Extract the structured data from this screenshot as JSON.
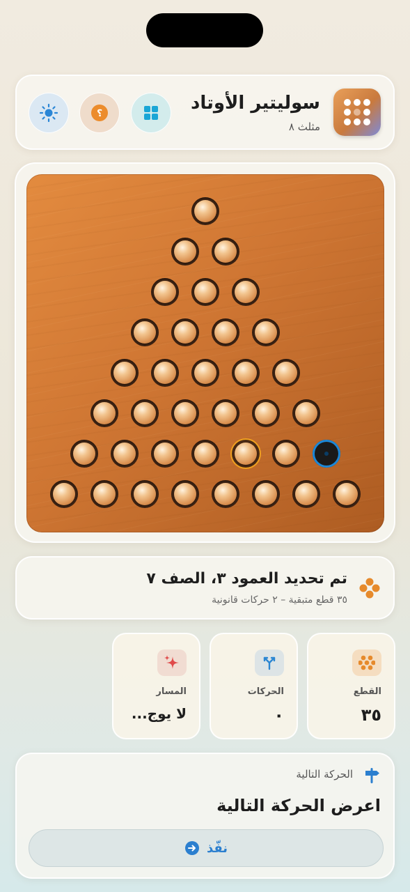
{
  "header": {
    "title": "سوليتير الأوتاد",
    "subtitle": "مثلث ٨"
  },
  "board": {
    "rows": [
      [
        1
      ],
      [
        1,
        1
      ],
      [
        1,
        1,
        1
      ],
      [
        1,
        1,
        1,
        1
      ],
      [
        1,
        1,
        1,
        1,
        1
      ],
      [
        1,
        1,
        1,
        1,
        1,
        1
      ],
      [
        1,
        1,
        1,
        1,
        1,
        1,
        0
      ],
      [
        1,
        1,
        1,
        1,
        1,
        1,
        1,
        1
      ]
    ],
    "selected": {
      "row": 7,
      "col": 5
    },
    "target": {
      "row": 7,
      "col": 7
    }
  },
  "status": {
    "title": "تم تحديد العمود ٣، الصف ٧",
    "subtitle": "٣٥ قطع متبقية – ٢ حركات قانونية"
  },
  "stats": {
    "pieces": {
      "label": "القطع",
      "value": "٣٥"
    },
    "moves": {
      "label": "الحركات",
      "value": "٠"
    },
    "path": {
      "label": "المسار",
      "value": "لا يوج..."
    }
  },
  "next": {
    "label": "الحركة التالية",
    "title": "اعرض الحركة التالية",
    "button_label": "نفّذ"
  },
  "colors": {
    "accent": "#2b7fcf",
    "wood": "#d07a35",
    "selected_ring": "#f0a020",
    "target_ring": "#1c88d8"
  }
}
